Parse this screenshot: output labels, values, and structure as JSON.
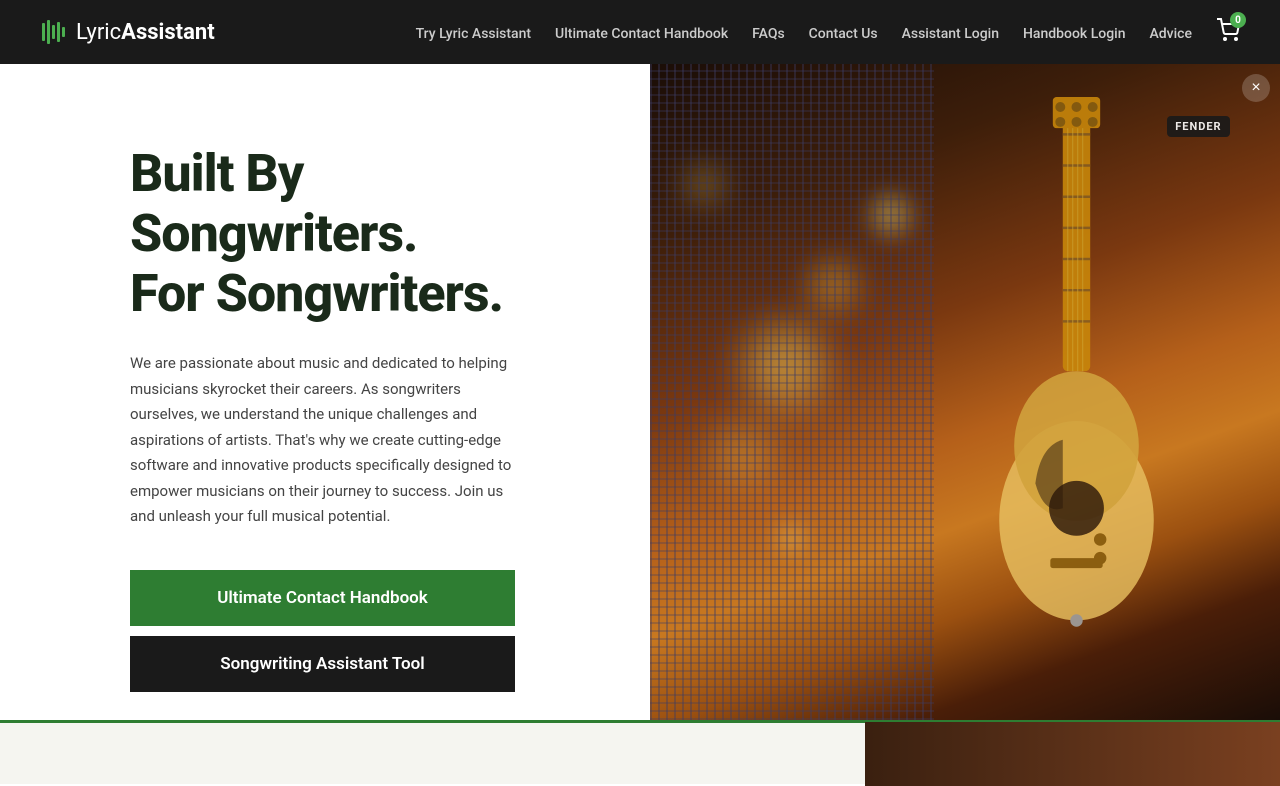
{
  "brand": {
    "name_lyric": "Lyric",
    "name_assistant": "Assistant",
    "icon": "♫"
  },
  "nav": {
    "items": [
      {
        "label": "Try Lyric Assistant",
        "href": "#"
      },
      {
        "label": "Ultimate Contact Handbook",
        "href": "#"
      },
      {
        "label": "FAQs",
        "href": "#"
      },
      {
        "label": "Contact Us",
        "href": "#"
      },
      {
        "label": "Assistant Login",
        "href": "#"
      },
      {
        "label": "Handbook Login",
        "href": "#"
      },
      {
        "label": "Advice",
        "href": "#"
      }
    ],
    "cart_count": "0"
  },
  "hero": {
    "heading_line1": "Built By",
    "heading_line2": "Songwriters.",
    "heading_line3": "For Songwriters.",
    "body_text": "We are passionate about music and dedicated to helping musicians skyrocket their careers. As songwriters ourselves, we understand the unique challenges and aspirations of artists. That's why we create cutting-edge software and innovative products specifically designed to empower musicians on their journey to success. Join us and unleash your full musical potential.",
    "btn_primary_label": "Ultimate Contact Handbook",
    "btn_secondary_label": "Songwriting Assistant Tool",
    "fender_badge": "FENDER",
    "close_label": "×"
  }
}
